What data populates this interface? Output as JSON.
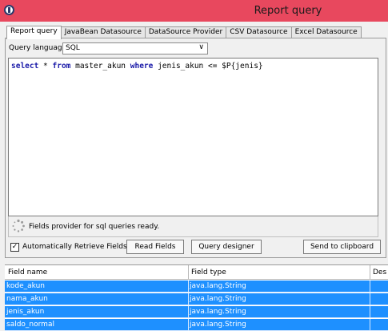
{
  "window": {
    "title": "Report query"
  },
  "tabs": [
    {
      "label": "Report query",
      "active": true
    },
    {
      "label": "JavaBean Datasource",
      "active": false
    },
    {
      "label": "DataSource Provider",
      "active": false
    },
    {
      "label": "CSV Datasource",
      "active": false
    },
    {
      "label": "Excel Datasource",
      "active": false
    }
  ],
  "query_language": {
    "label": "Query language",
    "value": "SQL"
  },
  "editor": {
    "query_parts": [
      "select",
      " * ",
      "from",
      " master_akun ",
      "where",
      " jenis_akun <= $P{jenis}"
    ]
  },
  "status": {
    "text": "Fields provider for sql queries ready."
  },
  "auto_retrieve": {
    "label": "Automatically Retrieve Fields",
    "checked": true
  },
  "buttons": {
    "read_fields": "Read Fields",
    "query_designer": "Query designer",
    "send_to_clipboard": "Send to clipboard"
  },
  "fields_table": {
    "columns": [
      "Field name",
      "Field type",
      "Des"
    ],
    "rows": [
      {
        "name": "kode_akun",
        "type": "java.lang.String"
      },
      {
        "name": "nama_akun",
        "type": "java.lang.String"
      },
      {
        "name": "jenis_akun",
        "type": "java.lang.String"
      },
      {
        "name": "saldo_normal",
        "type": "java.lang.String"
      }
    ],
    "selection_color": "#1e90ff"
  },
  "colors": {
    "titlebar": "#e8485e",
    "keyword": "#1a1aa8"
  }
}
